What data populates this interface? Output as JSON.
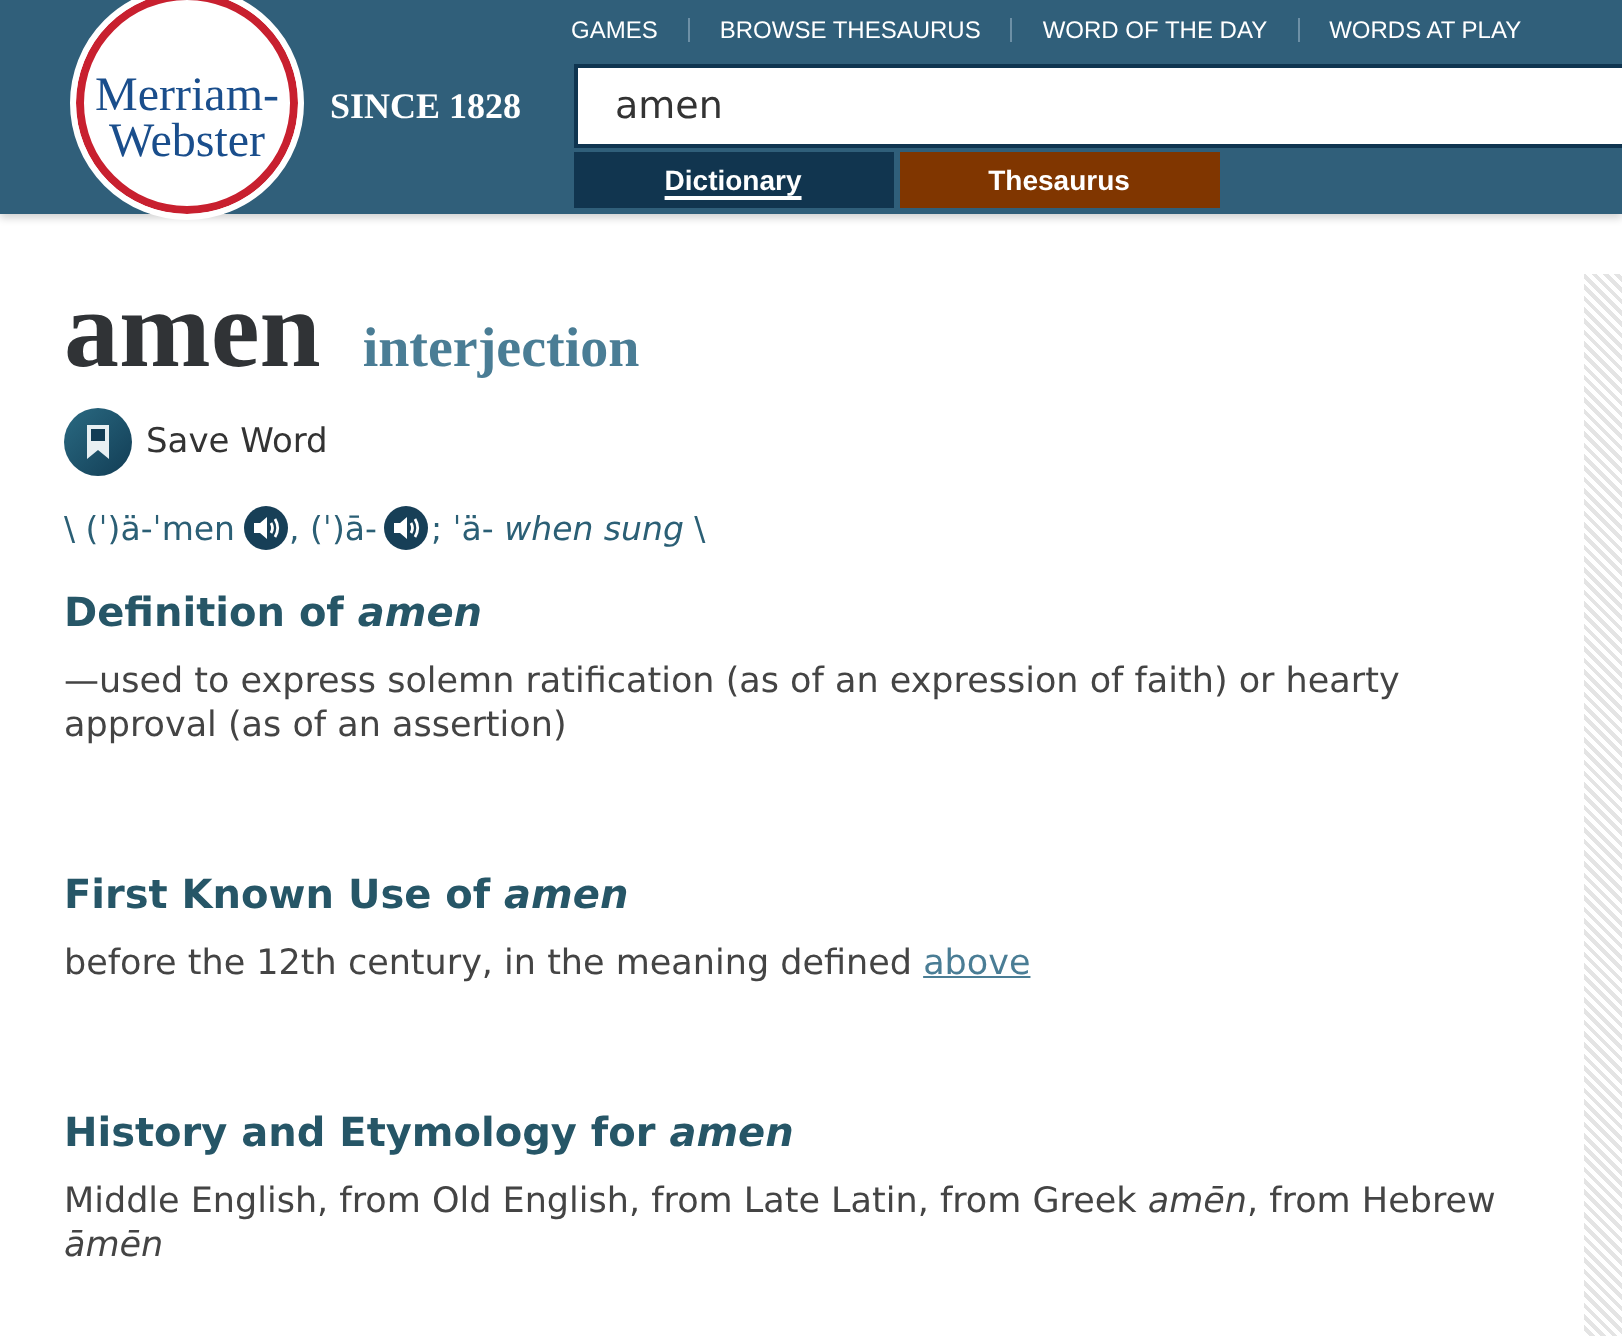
{
  "header": {
    "logo": [
      "Merriam-",
      "Webster"
    ],
    "tagline": "SINCE 1828",
    "nav": [
      "GAMES",
      "BROWSE THESAURUS",
      "WORD OF THE DAY",
      "WORDS AT PLAY"
    ],
    "search": {
      "value": "amen"
    },
    "tabs": [
      {
        "label": "Dictionary",
        "selected": true,
        "color": "#11354f"
      },
      {
        "label": "Thesaurus",
        "selected": false,
        "color": "#803600"
      }
    ]
  },
  "entry": {
    "headword": "amen",
    "part_of_speech": "interjection",
    "save_label": "Save Word",
    "pronunciation": [
      {
        "kind": "text",
        "text": "\\ (ˈ)ä-ˈmen"
      },
      {
        "kind": "audio"
      },
      {
        "kind": "text",
        "text": ", (ˈ)ā-"
      },
      {
        "kind": "audio"
      },
      {
        "kind": "text",
        "text": "; ˈä- *when sung* \\"
      }
    ]
  },
  "sections": [
    {
      "heading": "Definition of *amen*",
      "body": "—used to express solemn ratification (as of an expression of faith) or hearty approval (as of an assertion)"
    },
    {
      "heading": "First Known Use of *amen*",
      "body": "before the 12th century, in the meaning defined",
      "link": "above"
    },
    {
      "heading": "History and Etymology for *amen*",
      "body": "Middle English, from Old English, from Late Latin, from Greek *amēn*, from Hebrew *āmēn*"
    }
  ]
}
